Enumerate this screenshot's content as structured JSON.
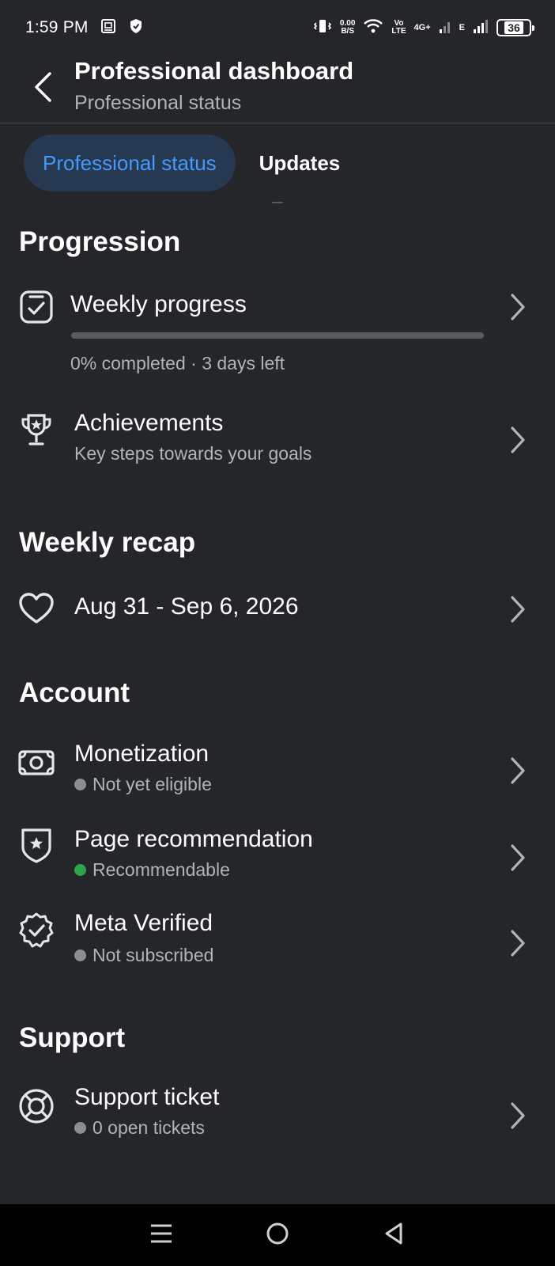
{
  "status_bar": {
    "time": "1:59 PM",
    "speed_value": "0.00",
    "speed_unit": "B/S",
    "volte_top": "Vo",
    "volte_bottom": "LTE",
    "network_4g": "4G+",
    "network_e": "E",
    "battery": "36"
  },
  "header": {
    "title": "Professional dashboard",
    "subtitle": "Professional status"
  },
  "tabs": [
    {
      "label": "Professional status",
      "active": true
    },
    {
      "label": "Updates",
      "active": false
    }
  ],
  "sections": {
    "progression": {
      "title": "Progression",
      "weekly_progress": {
        "title": "Weekly progress",
        "progress_fraction": 0.0,
        "status": "0% completed · 3 days left"
      },
      "achievements": {
        "title": "Achievements",
        "subtitle": "Key steps towards your goals"
      }
    },
    "weekly_recap": {
      "title": "Weekly recap",
      "date_range": "Aug 31 - Sep 6, 2026"
    },
    "account": {
      "title": "Account",
      "monetization": {
        "title": "Monetization",
        "status": "Not yet eligible",
        "status_color": "#8a8d91"
      },
      "page_recommendation": {
        "title": "Page recommendation",
        "status": "Recommendable",
        "status_color": "#31a24c"
      },
      "meta_verified": {
        "title": "Meta Verified",
        "status": "Not subscribed",
        "status_color": "#8a8d91"
      }
    },
    "support": {
      "title": "Support",
      "support_ticket": {
        "title": "Support ticket",
        "status": "0 open tickets",
        "status_color": "#8a8d91"
      }
    }
  },
  "icons": {
    "back": "back-arrow-icon",
    "weekly_progress": "clipboard-check-icon",
    "achievements": "trophy-icon",
    "weekly_recap": "heart-icon",
    "monetization": "banknote-icon",
    "page_recommendation": "shield-star-icon",
    "meta_verified": "verified-badge-icon",
    "support_ticket": "lifebuoy-icon",
    "chevron": "chevron-right-icon"
  },
  "colors": {
    "background": "#252629",
    "accent": "#4599ff",
    "active_tab_bg": "#263951",
    "secondary_text": "#b0b3b8"
  }
}
